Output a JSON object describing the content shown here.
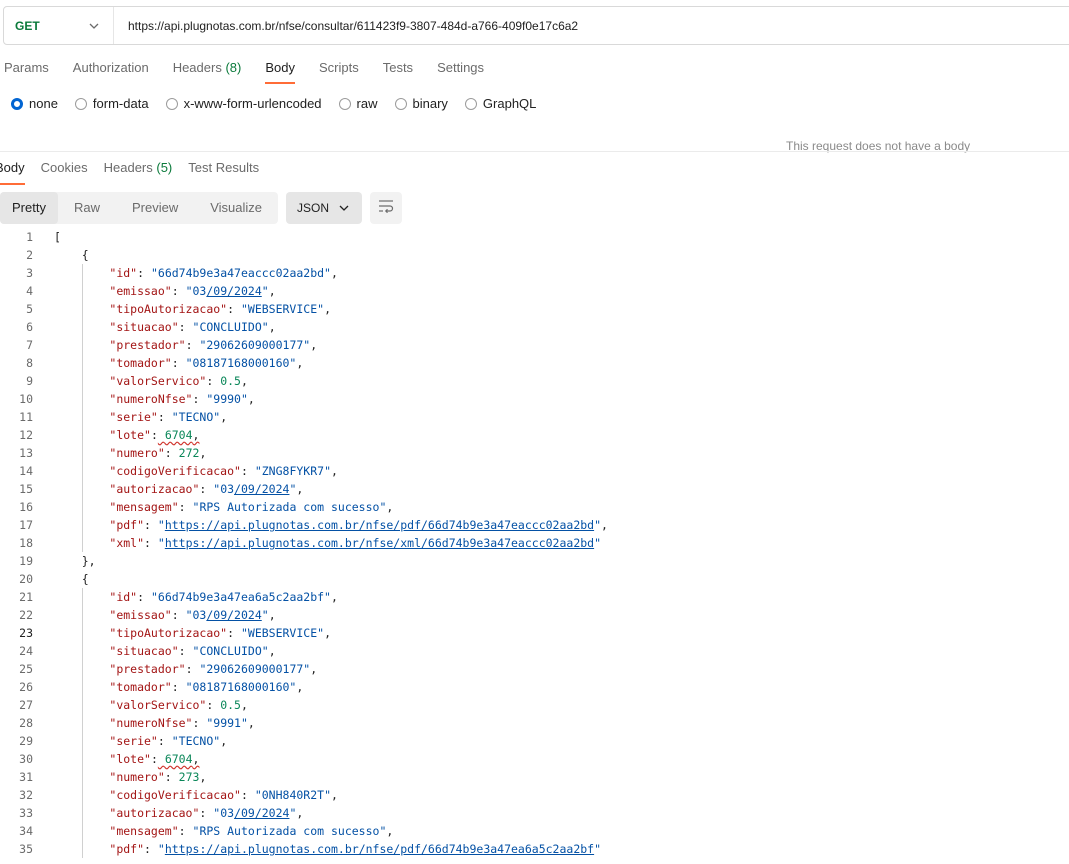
{
  "request": {
    "method": "GET",
    "url": "https://api.plugnotas.com.br/nfse/consultar/611423f9-3807-484d-a766-409f0e17c6a2"
  },
  "request_tabs": [
    {
      "label": "Params",
      "count": ""
    },
    {
      "label": "Authorization",
      "count": ""
    },
    {
      "label": "Headers",
      "count": "(8)"
    },
    {
      "label": "Body",
      "count": "",
      "active": true
    },
    {
      "label": "Scripts",
      "count": ""
    },
    {
      "label": "Tests",
      "count": ""
    },
    {
      "label": "Settings",
      "count": ""
    }
  ],
  "body_types": [
    "none",
    "form-data",
    "x-www-form-urlencoded",
    "raw",
    "binary",
    "GraphQL"
  ],
  "body_type_selected": "none",
  "no_body_message": "This request does not have a body",
  "response_tabs": [
    {
      "label": "Body",
      "count": "",
      "active": true
    },
    {
      "label": "Cookies",
      "count": ""
    },
    {
      "label": "Headers",
      "count": "(5)"
    },
    {
      "label": "Test Results",
      "count": ""
    }
  ],
  "view_modes": [
    "Pretty",
    "Raw",
    "Preview",
    "Visualize"
  ],
  "view_mode_selected": "Pretty",
  "format": "JSON",
  "current_line": 23,
  "response_json": [
    {
      "id": "66d74b9e3a47eaccc02aa2bd",
      "emissao": "03/09/2024",
      "tipoAutorizacao": "WEBSERVICE",
      "situacao": "CONCLUIDO",
      "prestador": "29062609000177",
      "tomador": "08187168000160",
      "valorServico": 0.5,
      "numeroNfse": "9990",
      "serie": "TECNO",
      "lote": 6704,
      "numero": 272,
      "codigoVerificacao": "ZNG8FYKR7",
      "autorizacao": "03/09/2024",
      "mensagem": "RPS Autorizada com sucesso",
      "pdf": "https://api.plugnotas.com.br/nfse/pdf/66d74b9e3a47eaccc02aa2bd",
      "xml": "https://api.plugnotas.com.br/nfse/xml/66d74b9e3a47eaccc02aa2bd"
    },
    {
      "id": "66d74b9e3a47ea6a5c2aa2bf",
      "emissao": "03/09/2024",
      "tipoAutorizacao": "WEBSERVICE",
      "situacao": "CONCLUIDO",
      "prestador": "29062609000177",
      "tomador": "08187168000160",
      "valorServico": 0.5,
      "numeroNfse": "9991",
      "serie": "TECNO",
      "lote": 6704,
      "numero": 273,
      "codigoVerificacao": "0NH840R2T",
      "autorizacao": "03/09/2024",
      "mensagem": "RPS Autorizada com sucesso",
      "pdf": "https://api.plugnotas.com.br/nfse/pdf/66d74b9e3a47ea6a5c2aa2bf"
    }
  ]
}
